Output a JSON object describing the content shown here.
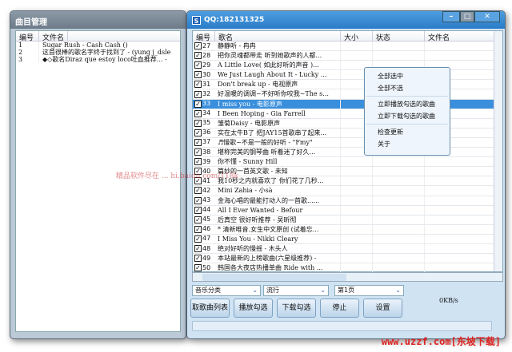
{
  "left": {
    "title": "曲目管理",
    "headers": [
      "编号",
      "文件名"
    ],
    "rows": [
      {
        "no": "1",
        "name": "Sugar Rush - Cash Cash ()"
      },
      {
        "no": "2",
        "name": "这首很棒的歌名字终于找到了 - (yung j_dsle"
      },
      {
        "no": "3",
        "name": "◆◇歌名Diraz que estoy loco吐血推荐... -"
      }
    ]
  },
  "right": {
    "title": "QQ:182131325",
    "logo": "S",
    "headers": [
      "编号",
      "歌名",
      "大小",
      "状态",
      "文件名"
    ],
    "rows": [
      {
        "no": "27",
        "name": "静静听 - 冉冉"
      },
      {
        "no": "28",
        "name": "把你灵魂都带走 听到她歌声的人都..."
      },
      {
        "no": "29",
        "name": "A Little Love( 如此好听的声音 )..."
      },
      {
        "no": "30",
        "name": "We Just Laugh About It - Lucky ..."
      },
      {
        "no": "31",
        "name": "Don't break up - 电视原声"
      },
      {
        "no": "32",
        "name": "好温暖的调调~不好听你咬我~The s..."
      },
      {
        "no": "33",
        "name": "I miss you - 电影原声"
      },
      {
        "no": "34",
        "name": "I Been Hoping - Gia Farrell"
      },
      {
        "no": "35",
        "name": "雏菊Daisy - 电影原声"
      },
      {
        "no": "36",
        "name": "实在太牛B了 把JAY15首歌串了起来..."
      },
      {
        "no": "37",
        "name": "♬慢歌~不是一般的好听 - \"Fmy\""
      },
      {
        "no": "38",
        "name": "堪称完美的钢琴曲   听着迷了好久..."
      },
      {
        "no": "39",
        "name": "你不懂 - Sunny Hill"
      },
      {
        "no": "40",
        "name": "篇妙的一首英文歌 - 未知"
      },
      {
        "no": "41",
        "name": "我10秒之内就喜欢了 你们花了几秒..."
      },
      {
        "no": "42",
        "name": "Mini Zahia - 小sà"
      },
      {
        "no": "43",
        "name": "金海心唱的最能打动人的一首歌......"
      },
      {
        "no": "44",
        "name": "All I Ever Wanted - Befour"
      },
      {
        "no": "45",
        "name": "后真空 很好听推荐 - 吴昕彻"
      },
      {
        "no": "46",
        "name": "* 清新唯音.女生中文原创 (试着忘..."
      },
      {
        "no": "47",
        "name": "I Miss You - Nikki  Cleary"
      },
      {
        "no": "48",
        "name": "绝对好听的慢摇 - 木头人"
      },
      {
        "no": "49",
        "name": "本站最新的上榜歌曲(六星级推荐) -"
      },
      {
        "no": "50",
        "name": "韩国各大夜店热播单曲 Ride with ..."
      }
    ],
    "selected_no": "33",
    "category": "音乐分类",
    "genre": "流行",
    "page": "第1页",
    "buttons": {
      "fetch": "取歌曲列表",
      "play": "播放勾选",
      "download": "下载勾选",
      "stop": "停止",
      "settings": "设置"
    },
    "speed": "0KB/s"
  },
  "menu": {
    "select_all": "全部选中",
    "select_none": "全部不选",
    "play_now": "立即播放勾选的歌曲",
    "download_now": "立即下载勾选的歌曲",
    "check_update": "检查更新",
    "about": "关于"
  },
  "watermarks": {
    "middle": "精品软件尽在 ... hi.baidu.com/118k",
    "bottom": "www.uzzf.com[东坡下载]"
  }
}
